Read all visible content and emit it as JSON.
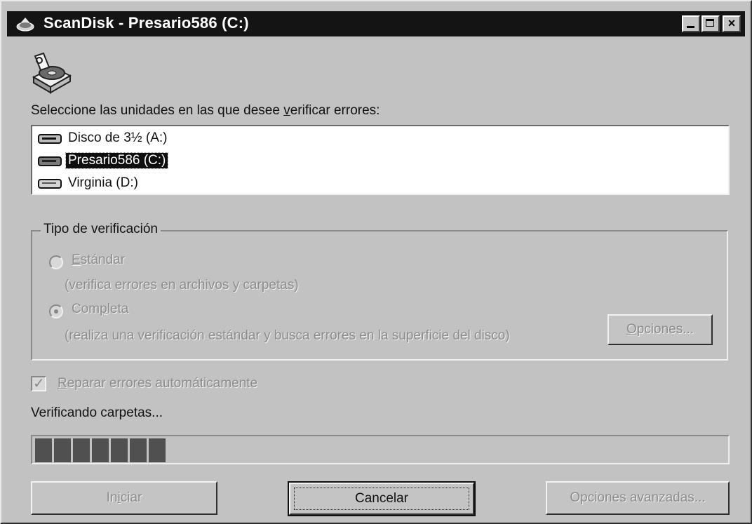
{
  "window": {
    "title": "ScanDisk - Presario586 (C:)",
    "controls": {
      "minimize": "minimize",
      "maximize": "maximize",
      "close": "×"
    }
  },
  "prompt": {
    "before": "Seleccione las unidades en las que desee ",
    "accel": "v",
    "after": "erificar errores:"
  },
  "drives": [
    {
      "label": "Disco de 3½ (A:)",
      "selected": false
    },
    {
      "label": "Presario586 (C:)",
      "selected": true
    },
    {
      "label": "Virginia (D:)",
      "selected": false
    }
  ],
  "verification": {
    "legend": "Tipo de verificación",
    "standard": {
      "accel": "E",
      "rest": "stándar",
      "description": "(verifica errores en archivos y carpetas)",
      "checked": false
    },
    "complete": {
      "pre": "Com",
      "accel": "p",
      "rest": "leta",
      "description": "(realiza una verificación estándar y busca errores en la superficie del disco)",
      "checked": true
    },
    "options_button": {
      "accel": "O",
      "rest": "pciones..."
    }
  },
  "auto_fix": {
    "accel": "R",
    "rest": "eparar errores automáticamente",
    "checked": true
  },
  "status": "Verificando carpetas...",
  "progress": {
    "filled_blocks": 7
  },
  "buttons": {
    "start": {
      "pre": "In",
      "accel": "i",
      "rest": "ciar"
    },
    "cancel": "Cancelar",
    "advanced": "Opciones avanzadas..."
  }
}
